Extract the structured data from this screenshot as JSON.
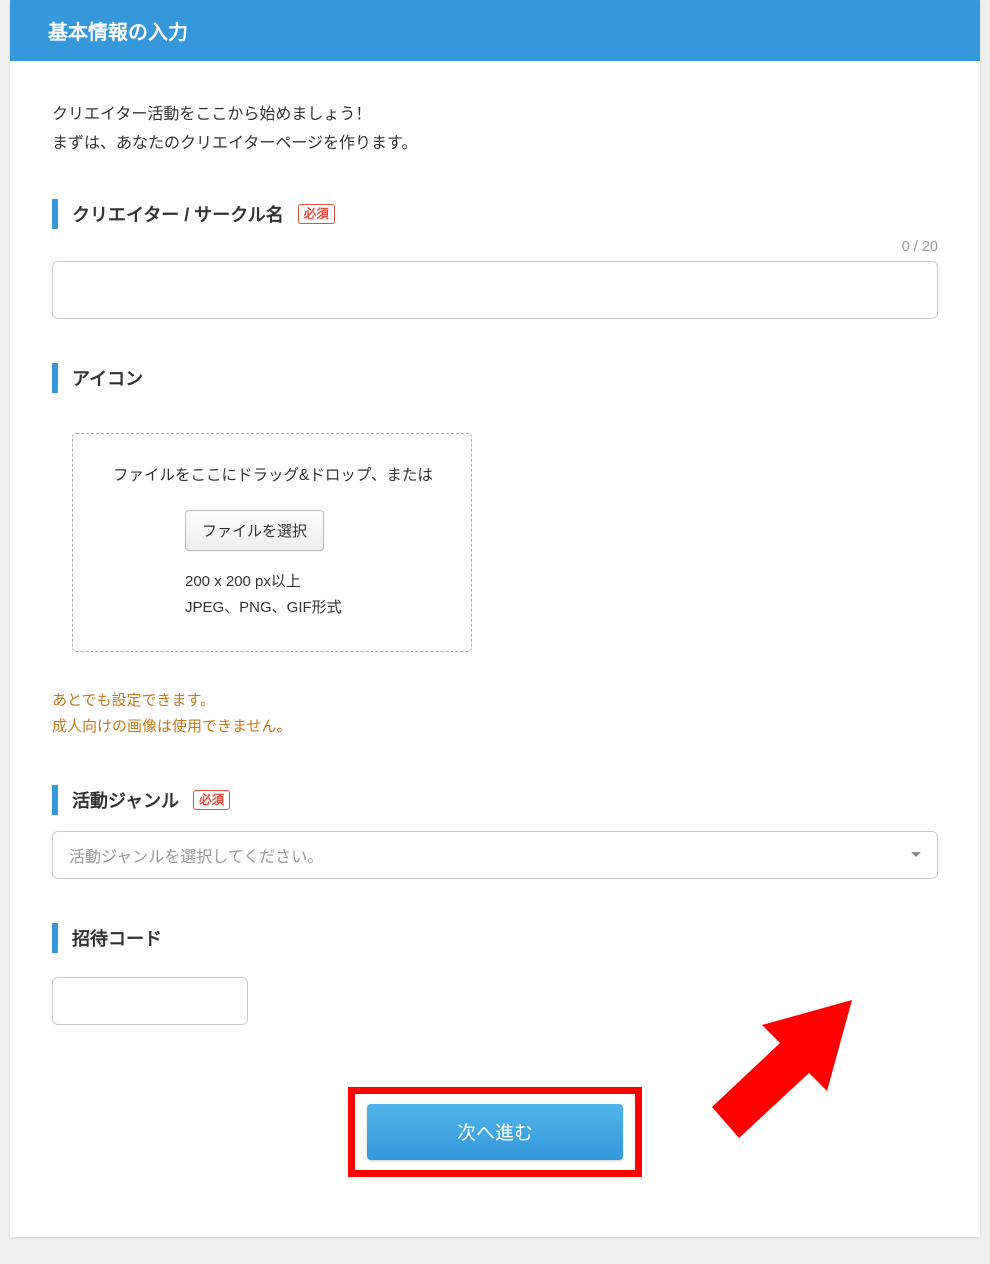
{
  "header": {
    "title": "基本情報の入力"
  },
  "intro": {
    "line1": "クリエイター活動をここから始めましょう！",
    "line2": "まずは、あなたのクリエイターページを作ります。"
  },
  "required_badge": "必須",
  "name": {
    "label": "クリエイター / サークル名",
    "counter": "0 / 20",
    "value": ""
  },
  "icon": {
    "label": "アイコン",
    "drop_text": "ファイルをここにドラッグ&ドロップ、または",
    "file_button": "ファイルを選択",
    "hint1": "200 x 200 px以上",
    "hint2": "JPEG、PNG、GIF形式",
    "note1": "あとでも設定できます。",
    "note2": "成人向けの画像は使用できません。"
  },
  "genre": {
    "label": "活動ジャンル",
    "placeholder": "活動ジャンルを選択してください。",
    "value": ""
  },
  "invite": {
    "label": "招待コード",
    "value": ""
  },
  "submit": {
    "label": "次へ進む"
  }
}
